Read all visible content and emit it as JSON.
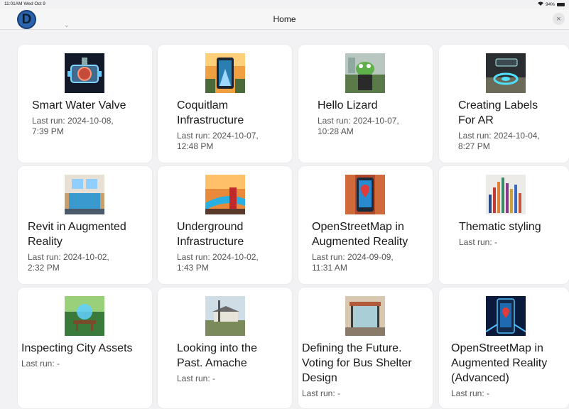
{
  "status_bar": {
    "time": "11:01AM  Wed Oct 9",
    "battery": "94%"
  },
  "nav": {
    "title": "Home",
    "avatar_initial": "D",
    "close_glyph": "×"
  },
  "cards": [
    {
      "title": "Smart Water Valve",
      "subtitle": "Last run: 2024-10-08,\n7:39 PM",
      "image": "smart-water-valve"
    },
    {
      "title": "Coquitlam\nInfrastructure",
      "subtitle": "Last run: 2024-10-07,\n12:48 PM",
      "image": "coquitlam-infrastructure"
    },
    {
      "title": "Hello Lizard",
      "subtitle": "Last run: 2024-10-07,\n10:28 AM",
      "image": "hello-lizard"
    },
    {
      "title": "Creating Labels\nFor AR",
      "subtitle": "Last run: 2024-10-04,\n8:27 PM",
      "image": "creating-labels-ar"
    },
    {
      "title": "Revit in Augmented\nReality",
      "subtitle": "Last run: 2024-10-02,\n2:32 PM",
      "image": "revit-ar"
    },
    {
      "title": "Underground\nInfrastructure",
      "subtitle": "Last run: 2024-10-02,\n1:43 PM",
      "image": "underground-infrastructure"
    },
    {
      "title": "OpenStreetMap in\nAugmented Reality",
      "subtitle": "Last run: 2024-09-09,\n11:31 AM",
      "image": "openstreetmap-ar"
    },
    {
      "title": "Thematic styling",
      "subtitle": "Last run: -",
      "image": "thematic-styling"
    },
    {
      "title": "Inspecting City Assets",
      "subtitle": "Last run: -",
      "image": "inspecting-city-assets"
    },
    {
      "title": "Looking into the\nPast. Amache",
      "subtitle": "Last run: -",
      "image": "amache"
    },
    {
      "title": "Defining the Future.\nVoting for Bus Shelter\nDesign",
      "subtitle": "Last run: -",
      "image": "bus-shelter"
    },
    {
      "title": "OpenStreetMap in\nAugmented Reality\n(Advanced)",
      "subtitle": "Last run: -",
      "image": "openstreetmap-ar-advanced"
    }
  ]
}
